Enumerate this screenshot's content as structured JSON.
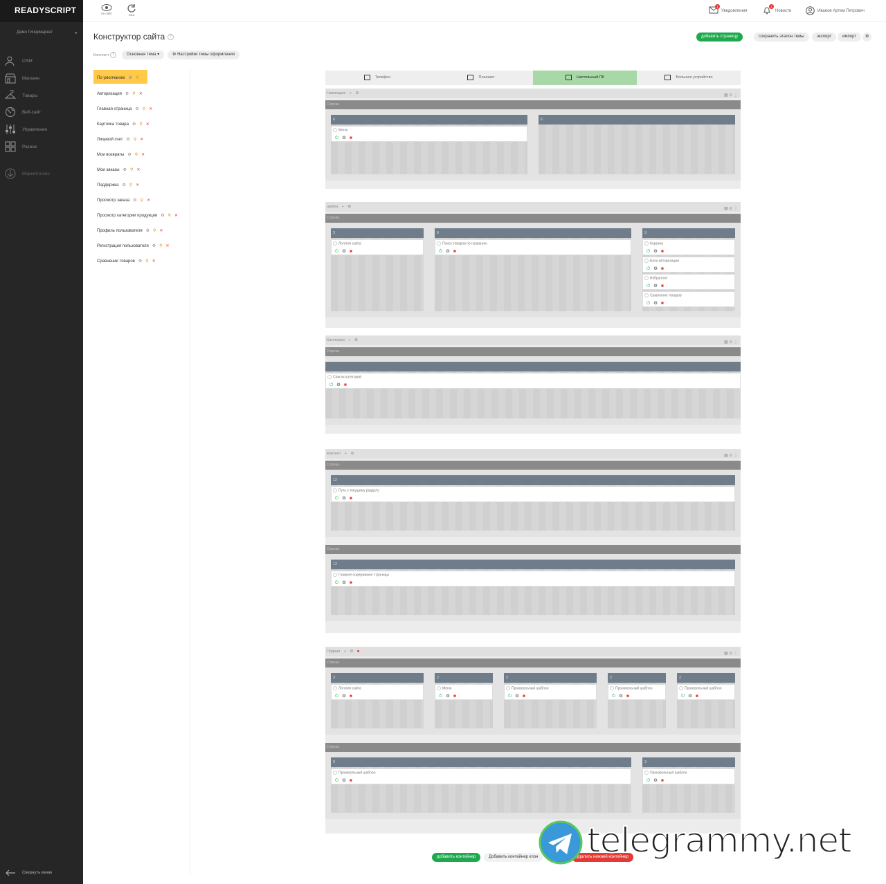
{
  "app": {
    "logo": "READYSCRIPT",
    "store": "Демо Гипермаркет"
  },
  "nav": [
    {
      "label": "CRM",
      "icon": "users-icon"
    },
    {
      "label": "Магазин",
      "icon": "shop-icon"
    },
    {
      "label": "Товары",
      "icon": "hanger-icon"
    },
    {
      "label": "Веб-сайт",
      "icon": "globe-icon"
    },
    {
      "label": "Управление",
      "icon": "sliders-icon"
    },
    {
      "label": "Разное",
      "icon": "grid-icon"
    },
    {
      "label": "Маркетплейс",
      "icon": "download-icon"
    }
  ],
  "collapse": "Свернуть меню",
  "topbar": {
    "site": "на сайт",
    "cache": "кэш",
    "notifications": "Уведомления",
    "news": "Новости",
    "user": "Иванов Артем Петрович",
    "notif_count": "1",
    "news_count": "1"
  },
  "page": {
    "title": "Конструктор сайта",
    "context_label": "Контекст",
    "theme": "Основная тема",
    "theme_settings": "Настройки темы оформления"
  },
  "actions": {
    "add_page": "добавить страницу",
    "save_ref": "сохранить эталон темы",
    "export": "экспорт",
    "import": "импорт"
  },
  "pages": [
    "По умолчанию",
    "Авторизация",
    "Главная страница",
    "Карточка товара",
    "Лицевой счет",
    "Мои возвраты",
    "Мои заказы",
    "Поддержка",
    "Просмотр заказа",
    "Просмотр категории продукции",
    "Профиль пользователя",
    "Регистрация пользователя",
    "Сравнение товаров"
  ],
  "devices": [
    "Телефон",
    "Планшет",
    "Настольный ПК",
    "Большое устройство"
  ],
  "row_label": "Строка",
  "sections": [
    {
      "name": "Навигация",
      "rows": [
        {
          "cols": [
            {
              "n": "6",
              "blocks": [
                "Меню"
              ]
            },
            {
              "n": "6",
              "blocks": []
            }
          ]
        }
      ]
    },
    {
      "name": "шапка",
      "rows": [
        {
          "cols": [
            {
              "n": "3",
              "blocks": [
                "Логотип сайта"
              ]
            },
            {
              "n": "6",
              "blocks": [
                "Поиск товаров по названию"
              ]
            },
            {
              "n": "3",
              "blocks": [
                "Корзина",
                "Блок авторизации",
                "Избранное",
                "Сравнение товаров"
              ]
            }
          ]
        }
      ]
    },
    {
      "name": "Категории",
      "rows": [
        {
          "cols": [
            {
              "n": "",
              "blocks": [
                "Список категорий"
              ]
            }
          ]
        }
      ]
    },
    {
      "name": "Контент",
      "rows": [
        {
          "cols": [
            {
              "n": "12",
              "blocks": [
                "Путь к текущему разделу"
              ]
            }
          ]
        },
        {
          "cols": [
            {
              "n": "12",
              "blocks": [
                "Главное содержимое страницы"
              ]
            }
          ]
        }
      ]
    },
    {
      "name": "Подвал",
      "rows": [
        {
          "cols": [
            {
              "n": "3",
              "blocks": [
                "Логотип сайта"
              ]
            },
            {
              "n": "2",
              "blocks": [
                "Меню"
              ]
            },
            {
              "n": "3",
              "blocks": [
                "Произвольный шаблон"
              ]
            },
            {
              "n": "2",
              "blocks": [
                "Произвольный шаблон"
              ]
            },
            {
              "n": "2",
              "blocks": [
                "Произвольный шаблон"
              ]
            }
          ]
        },
        {
          "cols": [
            {
              "n": "9",
              "blocks": [
                "Произвольный шаблон"
              ]
            },
            {
              "n": "3",
              "blocks": [
                "Произвольный шаблон"
              ]
            }
          ]
        }
      ]
    }
  ],
  "bottom": {
    "add_container": "добавить контейнер",
    "add_clone": "Добавить контейнер клон",
    "delete_container": "удалить нижний контейнер"
  },
  "watermark": "telegrammy.net"
}
